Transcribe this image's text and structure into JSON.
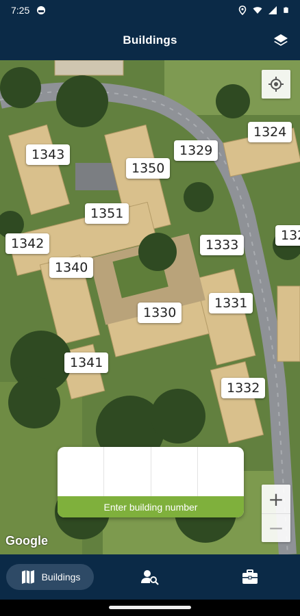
{
  "status_bar": {
    "time": "7:25",
    "icons": [
      "app-notification-icon",
      "location-icon",
      "wifi-icon",
      "signal-icon",
      "battery-icon"
    ]
  },
  "app_bar": {
    "title": "Buildings",
    "layers_icon": "layers-icon"
  },
  "map": {
    "buildings": [
      {
        "number": "1324"
      },
      {
        "number": "1343"
      },
      {
        "number": "1329"
      },
      {
        "number": "1350"
      },
      {
        "number": "1351"
      },
      {
        "number": "1342"
      },
      {
        "number": "1333"
      },
      {
        "number": "132"
      },
      {
        "number": "1340"
      },
      {
        "number": "1331"
      },
      {
        "number": "1330"
      },
      {
        "number": "1341"
      },
      {
        "number": "1332"
      }
    ],
    "attribution": "Google",
    "zoom_in_label": "+",
    "zoom_out_label": "−"
  },
  "building_entry": {
    "digit_count": 4,
    "hint": "Enter building number",
    "accent_color": "#7fb03c"
  },
  "bottom_nav": {
    "items": [
      {
        "label": "Buildings",
        "icon": "map-icon",
        "active": true
      },
      {
        "label": "",
        "icon": "person-search-icon",
        "active": false
      },
      {
        "label": "",
        "icon": "briefcase-icon",
        "active": false
      }
    ]
  },
  "colors": {
    "primary": "#0b2a47",
    "nav_active": "#2e4a66",
    "accent": "#7fb03c"
  }
}
